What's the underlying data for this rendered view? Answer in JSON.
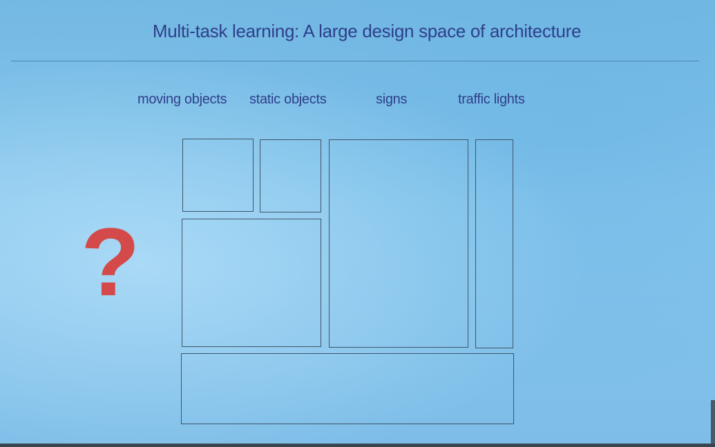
{
  "slide": {
    "title": "Multi-task learning: A large design space of architecture",
    "tasks": [
      "moving objects",
      "static objects",
      "signs",
      "traffic lights"
    ],
    "question_mark": "?",
    "colors": {
      "background": "#7dbde8",
      "title_text": "#2e3f8a",
      "question_mark": "#d44a4a",
      "box_border": "#3e5466"
    }
  }
}
